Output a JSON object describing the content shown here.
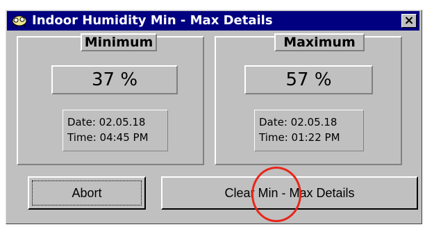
{
  "window": {
    "title": "Indoor Humidity Min - Max Details",
    "app_icon": "weather-station-icon",
    "close_label": "×"
  },
  "minimum": {
    "label": "Minimum",
    "value": "37 %",
    "date": "Date: 02.05.18",
    "time": "Time: 04:45 PM"
  },
  "maximum": {
    "label": "Maximum",
    "value": "57 %",
    "date": "Date: 02.05.18",
    "time": "Time: 01:22 PM"
  },
  "buttons": {
    "abort": "Abort",
    "clear": "Clear Min - Max Details"
  },
  "annotation": {
    "circle_color": "#e8261a"
  }
}
